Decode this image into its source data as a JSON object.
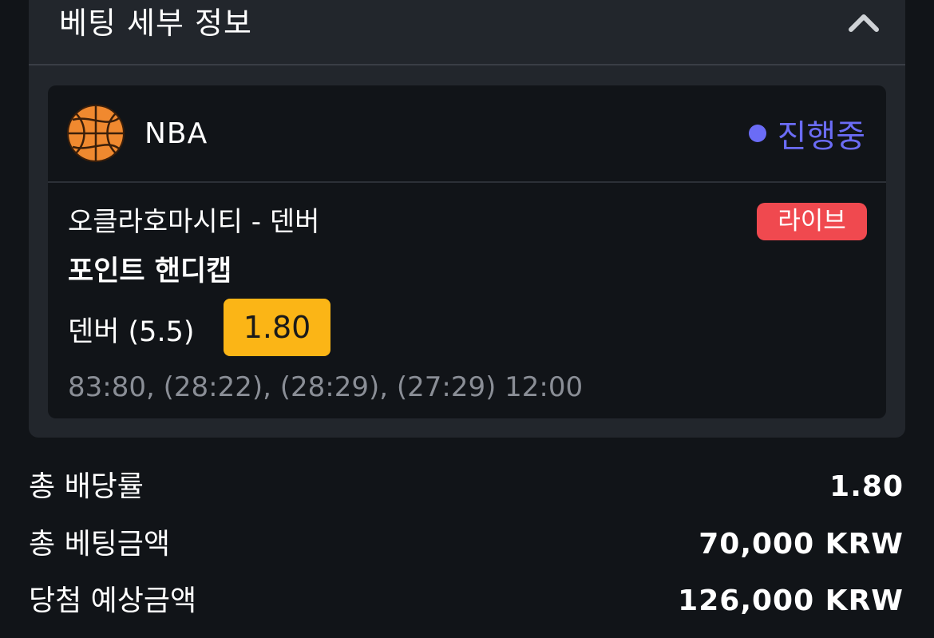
{
  "details": {
    "title": "베팅 세부 정보",
    "collapse_icon": "chevron-up-icon"
  },
  "bet": {
    "league": "NBA",
    "league_icon": "basketball-icon",
    "status": "진행중",
    "status_color": "#6b6cf6",
    "match": "오클라호마시티 - 덴버",
    "live_label": "라이브",
    "live_color": "#f0494f",
    "market": "포인트 핸디캡",
    "selection": "덴버 (5.5)",
    "odds": "1.80",
    "odds_color": "#fbb516",
    "score": "83:80, (28:22), (28:29), (27:29) 12:00"
  },
  "summary": {
    "total_odds_label": "총 배당률",
    "total_odds_value": "1.80",
    "total_stake_label": "총 베팅금액",
    "total_stake_value": "70,000 KRW",
    "expected_win_label": "당첨 예상금액",
    "expected_win_value": "126,000 KRW"
  }
}
